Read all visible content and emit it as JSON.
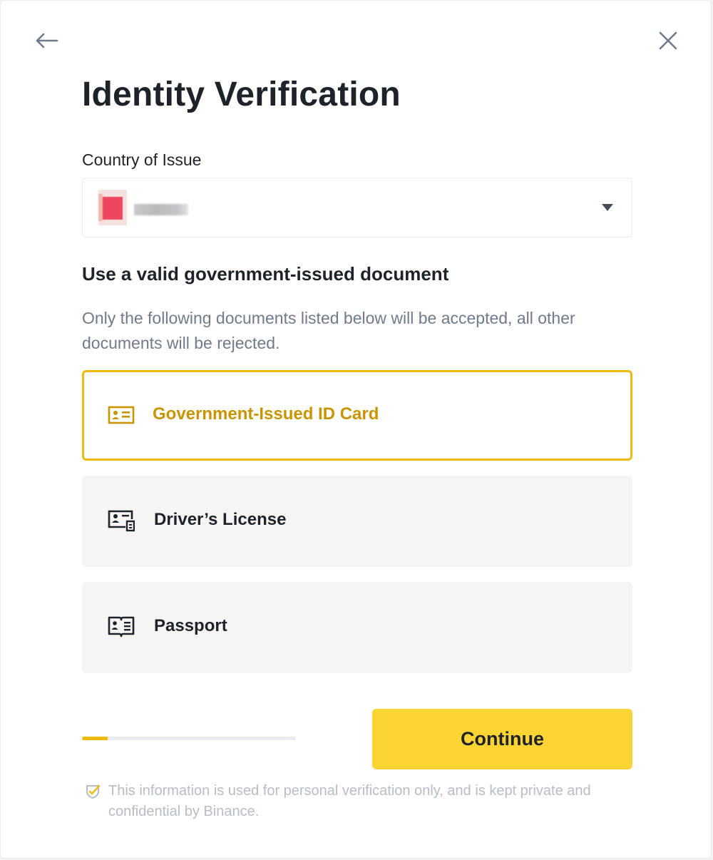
{
  "header": {
    "back_icon": "arrow-left-icon",
    "close_icon": "close-icon",
    "title": "Identity Verification"
  },
  "country": {
    "label": "Country of Issue",
    "selected_value": "",
    "flag_icon": "country-flag-icon",
    "dropdown_icon": "caret-down-icon"
  },
  "documents": {
    "heading": "Use a valid government-issued document",
    "description": "Only the following documents listed below will be accepted, all other documents will be rejected.",
    "options": [
      {
        "label": "Government-Issued ID Card",
        "icon": "id-card-icon",
        "selected": true
      },
      {
        "label": "Driver’s License",
        "icon": "drivers-license-icon",
        "selected": false
      },
      {
        "label": "Passport",
        "icon": "passport-icon",
        "selected": false
      }
    ]
  },
  "progress": {
    "value_percent": 12
  },
  "actions": {
    "continue_label": "Continue"
  },
  "footer": {
    "notice_icon": "shield-check-icon",
    "notice": "This information is used for personal verification only, and is kept private and confidential by Binance."
  },
  "colors": {
    "accent": "#F0B90B",
    "accent_text": "#C99400",
    "button": "#FCD535",
    "text_primary": "#1E2329",
    "text_secondary": "#707A8A",
    "text_muted": "#B7BDC6"
  }
}
